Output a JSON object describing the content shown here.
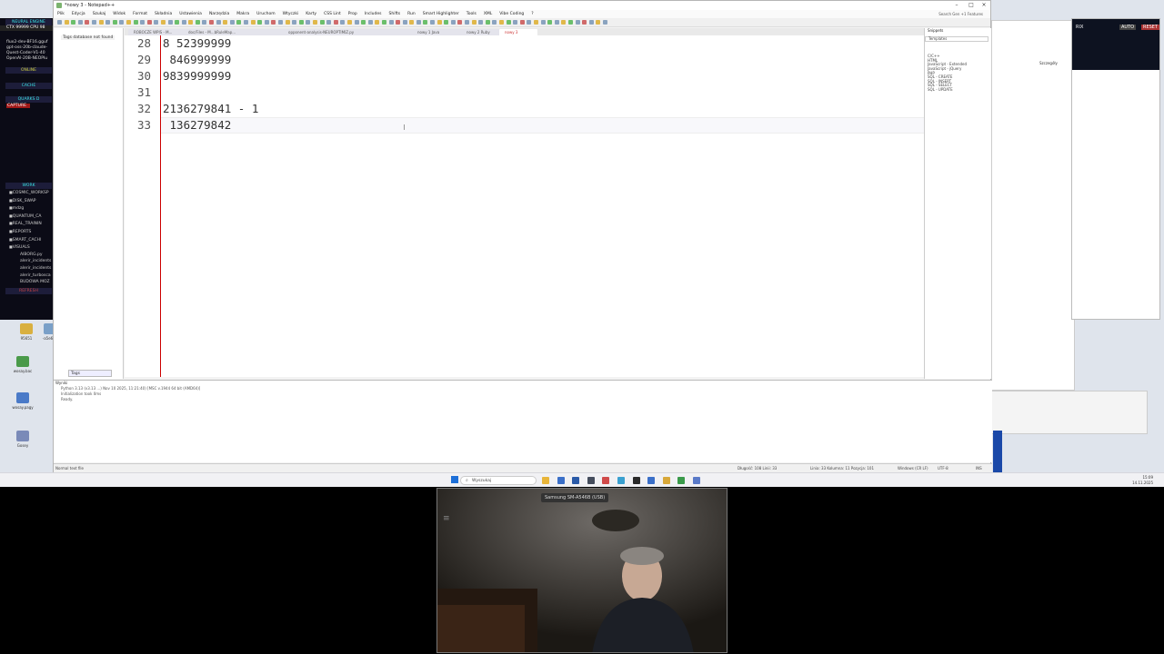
{
  "desktop": {
    "icons": [
      {
        "label": "95651",
        "color": "#d9b040"
      },
      {
        "label": "-a5e6e7",
        "color": "#7aa0c8"
      },
      {
        "label": "wosay.bac",
        "color": "#4a9a4a"
      },
      {
        "label": "wosay.pagy",
        "color": "#4a7ac8"
      },
      {
        "label": "Gosey",
        "color": "#7a8ab8"
      }
    ]
  },
  "left_panel": {
    "header": "NEURAL ENGINE",
    "gauges": [
      "CTX 99999  CPU 98"
    ],
    "models": [
      "flux2-dev-BF16.gguf",
      "gpt-oss-20b-claude-",
      "Quest-Coder-V1-40",
      "OpenAI-20B-NEOPlu"
    ],
    "online": "ONLINE",
    "cache": "CACHE",
    "quarks": "QUARKS D",
    "capture": "CAPTURE",
    "work": "WORK",
    "tree": [
      {
        "label": "COSMIC_WORKSP",
        "sub": false,
        "sq": true
      },
      {
        "label": "DISK_SWAP",
        "sub": false,
        "sq": true
      },
      {
        "label": "mdzg",
        "sub": false,
        "sq": true
      },
      {
        "label": "QUANTUM_CA",
        "sub": false,
        "sq": true
      },
      {
        "label": "REAL_TRAININ",
        "sub": false,
        "sq": true
      },
      {
        "label": "REPORTS",
        "sub": false,
        "sq": true
      },
      {
        "label": "SMART_CACHI",
        "sub": false,
        "sq": true
      },
      {
        "label": "VISUALS",
        "sub": false,
        "sq": true
      },
      {
        "label": "AIBORG.py",
        "sub": true,
        "sq": false
      },
      {
        "label": "alerir_incidents",
        "sub": true,
        "sq": false
      },
      {
        "label": "alerir_incidents",
        "sub": true,
        "sq": false
      },
      {
        "label": "alerir_turbosca",
        "sub": true,
        "sq": false
      },
      {
        "label": "BUDOWA MOZ",
        "sub": true,
        "sq": false
      }
    ],
    "refresh": "REFRESH"
  },
  "editor_window": {
    "title": "*nowy 3 - Notepad++",
    "menu": [
      "Plik",
      "Edycja",
      "Szukaj",
      "Widok",
      "Format",
      "Składnia",
      "Ustawienia",
      "Narzędzia",
      "Makra",
      "Uruchom",
      "Wtyczki",
      "Karty",
      "CSS Lint",
      "Prop",
      "Includes",
      "Shifts",
      "Run",
      "Smart Highlighter",
      "Tools",
      "XML",
      "Vibe Coding",
      "?"
    ],
    "search_hint": "Search Gen +1 Features",
    "tags_message": "Tags database not found",
    "tags_tab": "Tags",
    "tabs": [
      {
        "label": "ROBOCZE  WPIS - M...",
        "active": false
      },
      {
        "label": "doc/Files - M...bRuleMap...",
        "active": false
      },
      {
        "label": "opponent-analysis-NEUROPTIMIZ.py",
        "active": false
      },
      {
        "label": "nowy 1 Java",
        "active": false
      },
      {
        "label": "nowy 2 Ruby",
        "active": false
      },
      {
        "label": "nowy 3",
        "active": true
      }
    ],
    "lines": [
      {
        "num": "28",
        "text": "8 52399999"
      },
      {
        "num": "29",
        "text": " 846999999"
      },
      {
        "num": "30",
        "text": "9839999999"
      },
      {
        "num": "31",
        "text": ""
      },
      {
        "num": "32",
        "text": "2136279841 - 1"
      },
      {
        "num": "33",
        "text": " 136279842"
      }
    ],
    "right_panel": {
      "title": "Snippets",
      "subtitle": "Templates",
      "items": [
        "C/C++",
        "HTML",
        "JavaScript - Extended",
        "JavaScript - jQuery",
        "PHP",
        "SQL - CREATE",
        "SQL - INSERT",
        "SQL - SELECT",
        "SQL - UPDATE"
      ]
    },
    "messages": {
      "title": "Wyniki",
      "lines": [
        "Python 3.13 (v3.13 ...) Nov 10 2025, 11:21:40) [MSC v.1944 64 bit (AMD64)]",
        "Initialization took 0ms",
        "Ready."
      ]
    },
    "status": {
      "left": "Normal text file",
      "length": "Długość: 108   Linii: 33",
      "position": "Linia: 33    Kolumna: 11    Pozycja: 101",
      "eol": "Windows (CR LF)",
      "enc": "UTF-8",
      "mode": "INS"
    }
  },
  "right_window": {
    "button": "Szczegóły",
    "labels": [
      "RIX",
      "AUTO",
      "RESET"
    ]
  },
  "taskbar": {
    "search": "Wyszukaj",
    "icons": [
      "#e8b53a",
      "#3a6fc8",
      "#2a5aa8",
      "#444c5c",
      "#d04a4a",
      "#3aa0d0",
      "#2a2a2a",
      "#3a6fc8",
      "#d8a83a",
      "#3a9a4a",
      "#5a7ac8"
    ],
    "time": "15:09",
    "date": "14.11.2025"
  },
  "camera": {
    "label": "Samsung SM-A546B (USB)"
  }
}
